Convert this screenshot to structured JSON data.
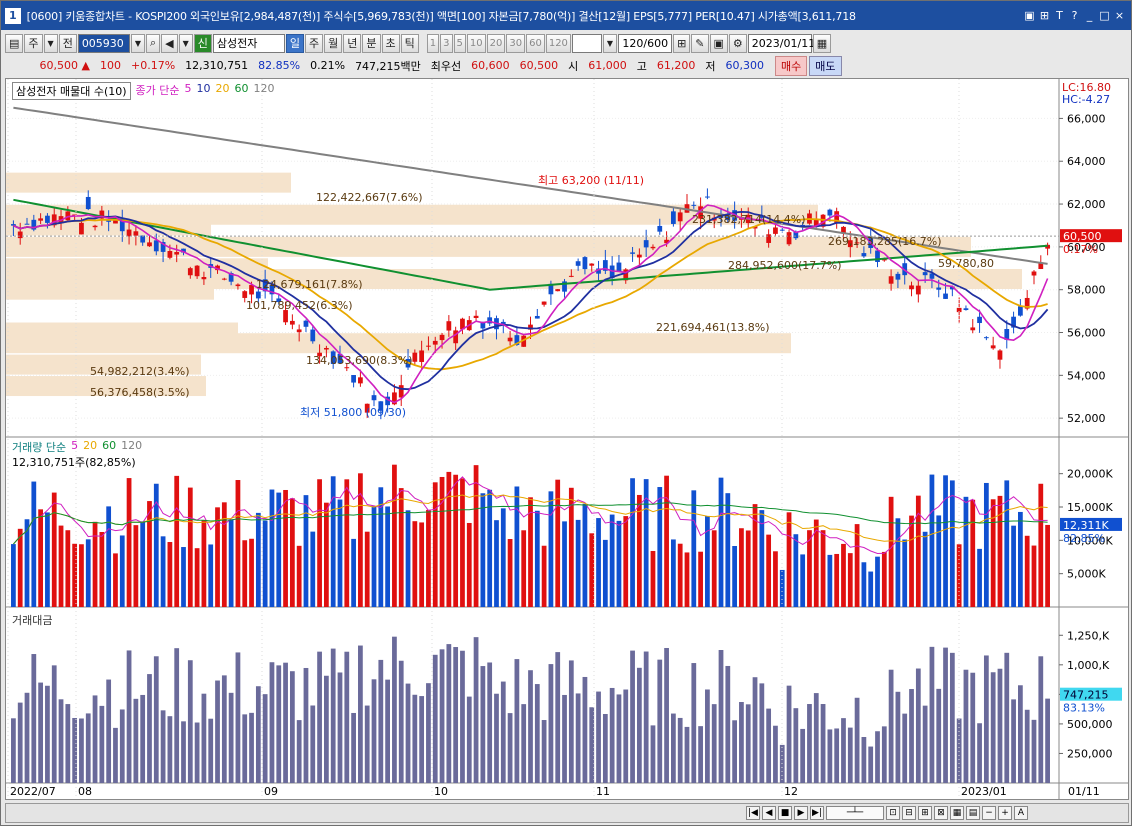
{
  "title": {
    "window_num": "1",
    "text": "[0600] 키움종합차트 - KOSPI200 외국인보유[2,984,487(천)] 주식수[5,969,783(천)] 액면[100] 자본금[7,780(억)] 결산[12월] EPS[5,777] PER[10.47] 시가총액[3,611,718"
  },
  "toolbar": {
    "period": "주",
    "prev": "전",
    "code": "005930",
    "stock_label": "신",
    "stock_name": "삼성전자",
    "tabs": [
      "일",
      "주",
      "월",
      "년",
      "분",
      "초",
      "틱"
    ],
    "nums": [
      "1",
      "3",
      "5",
      "10",
      "20",
      "30",
      "60",
      "120"
    ],
    "count": "120/600",
    "date": "2023/01/11"
  },
  "quote": {
    "price": "60,500",
    "change": "100",
    "pct": "+0.17%",
    "volume": "12,310,751",
    "vol_ratio": "82.85%",
    "turnover": "0.21%",
    "amount": "747,215백만",
    "pref_label": "최우선",
    "ask": "60,600",
    "bid": "60,500",
    "open_label": "시",
    "open": "61,000",
    "high_label": "고",
    "high": "61,200",
    "low_label": "저",
    "low": "60,300",
    "buy": "매수",
    "sell": "매도"
  },
  "price_panel": {
    "legend_name": "삼성전자 매물대 수(10)",
    "legend_ma": "종가 단순",
    "ma_periods": [
      "5",
      "10",
      "20",
      "60",
      "120"
    ],
    "lc": "LC:16.80",
    "hc": "HC:-4.27",
    "y_ticks": [
      "66,000",
      "64,000",
      "62,000",
      "60,000",
      "58,000",
      "56,000",
      "54,000",
      "52,000"
    ],
    "current": "60,500",
    "current_pct": "0.17%",
    "high_note": "최고 63,200 (11/11)",
    "low_note": "최저 51,800 (09/30)",
    "profile_labels": [
      "122,422,667(7.6%)",
      "124,679,161(7.8%)",
      "101,789,452(6.3%)",
      "54,982,212(3.4%)",
      "56,376,458(3.5%)",
      "221,694,461(13.8%)",
      "231,382,714(14.4%)",
      "269,183,285(16.7%)",
      "284,952,600(17.7%)",
      "59,780,80",
      "134,053,690(8.3%)"
    ]
  },
  "volume_panel": {
    "legend": "거래량 단순",
    "ma_periods": [
      "5",
      "20",
      "60",
      "120"
    ],
    "last": "12,310,751주(82,85%)",
    "y_ticks": [
      "20,000K",
      "15,000K",
      "10,000K",
      "5,000K"
    ],
    "current": "12,311K",
    "current_pct": "82.85%"
  },
  "amount_panel": {
    "legend": "거래대금",
    "y_ticks": [
      "1,250,K",
      "1,000,K",
      "750,000",
      "500,000",
      "250,000"
    ],
    "current": "747,215",
    "current_pct": "83.13%"
  },
  "x_axis": [
    "2022/07",
    "08",
    "09",
    "10",
    "11",
    "12",
    "2023/01",
    "01/11"
  ],
  "colors": {
    "up": "#e01010",
    "down": "#1050d0",
    "ma5": "#d020c0",
    "ma10": "#2030a0",
    "ma20": "#e8a800",
    "ma60": "#109030",
    "ma120": "#808080",
    "profile": "#f5e3cc",
    "amount": "#6a6a9a"
  }
}
